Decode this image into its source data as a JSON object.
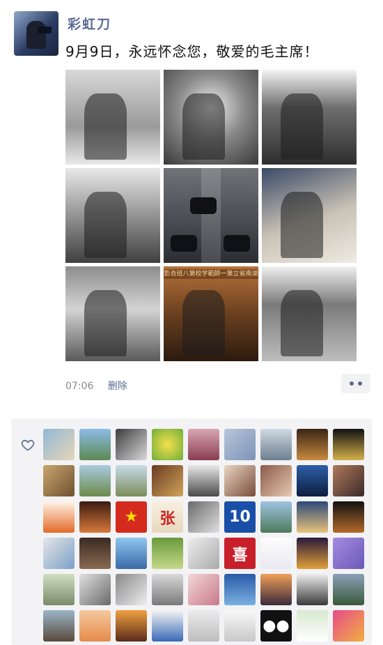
{
  "post": {
    "username": "彩虹刀",
    "text": "9月9日，永远怀念您，敬爱的毛主席！",
    "time": "07:06",
    "delete_label": "删除"
  },
  "photos": [
    {
      "name": "photo-1",
      "style": "bw1"
    },
    {
      "name": "photo-2",
      "style": "bw2"
    },
    {
      "name": "photo-3",
      "style": "bw3"
    },
    {
      "name": "photo-4",
      "style": "bw4"
    },
    {
      "name": "photo-5",
      "style": "col1"
    },
    {
      "name": "photo-6",
      "style": "col2"
    },
    {
      "name": "photo-7",
      "style": "bw5"
    },
    {
      "name": "photo-8",
      "style": "sep1",
      "caption": "影合班八第校学範師一第立省南湖"
    },
    {
      "name": "photo-9",
      "style": "bw6"
    }
  ],
  "likes": {
    "icon": "heart-outline-icon",
    "avatars": [
      {
        "bg": "linear-gradient(135deg,#8fb9d6,#e8d5b8)"
      },
      {
        "bg": "linear-gradient(180deg,#8dbbe8,#5d8a52)"
      },
      {
        "bg": "linear-gradient(135deg,#3c3c3c,#d9d9d9)"
      },
      {
        "bg": "radial-gradient(circle,#f5e04a,#6fae3b)"
      },
      {
        "bg": "linear-gradient(180deg,#d8a6b5,#8a3c4f)"
      },
      {
        "bg": "linear-gradient(135deg,#b9c6da,#7d93b8)"
      },
      {
        "bg": "linear-gradient(180deg,#cfd9e3,#6e7f8e)"
      },
      {
        "bg": "linear-gradient(180deg,#3a2516,#c88a3e)"
      },
      {
        "bg": "linear-gradient(180deg,#111111,#d4b24a)"
      },
      {
        "bg": "linear-gradient(135deg,#c9a56e,#6e5030)"
      },
      {
        "bg": "linear-gradient(180deg,#a9cbe0,#6b8a4a)"
      },
      {
        "bg": "linear-gradient(180deg,#c9dce9,#7a8c5a)"
      },
      {
        "bg": "linear-gradient(135deg,#6b3a22,#d0a45a)"
      },
      {
        "bg": "linear-gradient(180deg,#e8e8e8,#4a4a4a)"
      },
      {
        "bg": "linear-gradient(135deg,#e9d6c2,#7a4a3a)"
      },
      {
        "bg": "linear-gradient(135deg,#8a5a4a,#e6c9b0)"
      },
      {
        "bg": "linear-gradient(180deg,#2d5fa8,#0c1d3e)"
      },
      {
        "bg": "linear-gradient(135deg,#b07a5a,#3a2a2a)"
      },
      {
        "bg": "linear-gradient(180deg,#fff4e8,#e46a2a)"
      },
      {
        "bg": "linear-gradient(180deg,#3a1a12,#d97a3a)"
      },
      {
        "bg": "linear-gradient(180deg,#d52b1e,#d52b1e)",
        "text": "★",
        "color": "#ffde00"
      },
      {
        "bg": "linear-gradient(180deg,#f7efe1,#e8d9bd)",
        "text": "张",
        "color": "#c22"
      },
      {
        "bg": "linear-gradient(135deg,#6a6a6a,#e0e0e0)"
      },
      {
        "bg": "linear-gradient(180deg,#1a4fa8,#1a4fa8)",
        "text": "10",
        "color": "#fff"
      },
      {
        "bg": "linear-gradient(180deg,#9fc3e0,#4e7a5a)"
      },
      {
        "bg": "linear-gradient(180deg,#2c4a7a,#e9c27a)"
      },
      {
        "bg": "linear-gradient(180deg,#111,#b36a2a)"
      },
      {
        "bg": "linear-gradient(135deg,#e6e6e6,#7aa0c8)"
      },
      {
        "bg": "linear-gradient(180deg,#3a2a22,#8a6a52)"
      },
      {
        "bg": "linear-gradient(180deg,#8fc5f0,#3a6aa8)"
      },
      {
        "bg": "linear-gradient(180deg,#6a9a3a,#c6d88a)"
      },
      {
        "bg": "linear-gradient(135deg,#eee,#aaa)"
      },
      {
        "bg": "linear-gradient(180deg,#c8202a,#c8202a)",
        "text": "喜",
        "color": "#fff"
      },
      {
        "bg": "linear-gradient(180deg,#fdfdfd,#e8e8f0)"
      },
      {
        "bg": "linear-gradient(180deg,#2a1a3a,#e0a03a)"
      },
      {
        "bg": "linear-gradient(135deg,#a48ae0,#6a5ab8)"
      },
      {
        "bg": "linear-gradient(180deg,#cfe0c0,#7a8a6a)"
      },
      {
        "bg": "linear-gradient(135deg,#e0e0e0,#6a6a6a)"
      },
      {
        "bg": "linear-gradient(135deg,#888,#eee)"
      },
      {
        "bg": "linear-gradient(180deg,#d8d8d8,#7a7a7a)"
      },
      {
        "bg": "linear-gradient(135deg,#f2d6d6,#c87a8a)"
      },
      {
        "bg": "linear-gradient(180deg,#2a5aa8,#7ab0e0)"
      },
      {
        "bg": "linear-gradient(180deg,#f0a05a,#3a2a3a)"
      },
      {
        "bg": "linear-gradient(180deg,#eee,#3a3a3a)"
      },
      {
        "bg": "linear-gradient(180deg,#8aa0b8,#3a5a3a)"
      },
      {
        "bg": "linear-gradient(180deg,#9bb5c8,#5a4a3a)"
      },
      {
        "bg": "linear-gradient(180deg,#f5c9a0,#e58a4a)"
      },
      {
        "bg": "linear-gradient(180deg,#f0a040,#5a2a1a)"
      },
      {
        "bg": "linear-gradient(180deg,#f4f4f4,#3a6ab8)"
      },
      {
        "bg": "linear-gradient(180deg,#ececec,#bdbdbd)"
      },
      {
        "bg": "linear-gradient(180deg,#f8f8f8,#c8c8c8)"
      },
      {
        "bg": "radial-gradient(circle,#111 60%,#111)",
        "text": "●●",
        "color": "#fff"
      },
      {
        "bg": "linear-gradient(180deg,#d8e8d0,#ffffff)"
      },
      {
        "bg": "linear-gradient(135deg,#e84a8a,#f0b040)"
      }
    ]
  }
}
